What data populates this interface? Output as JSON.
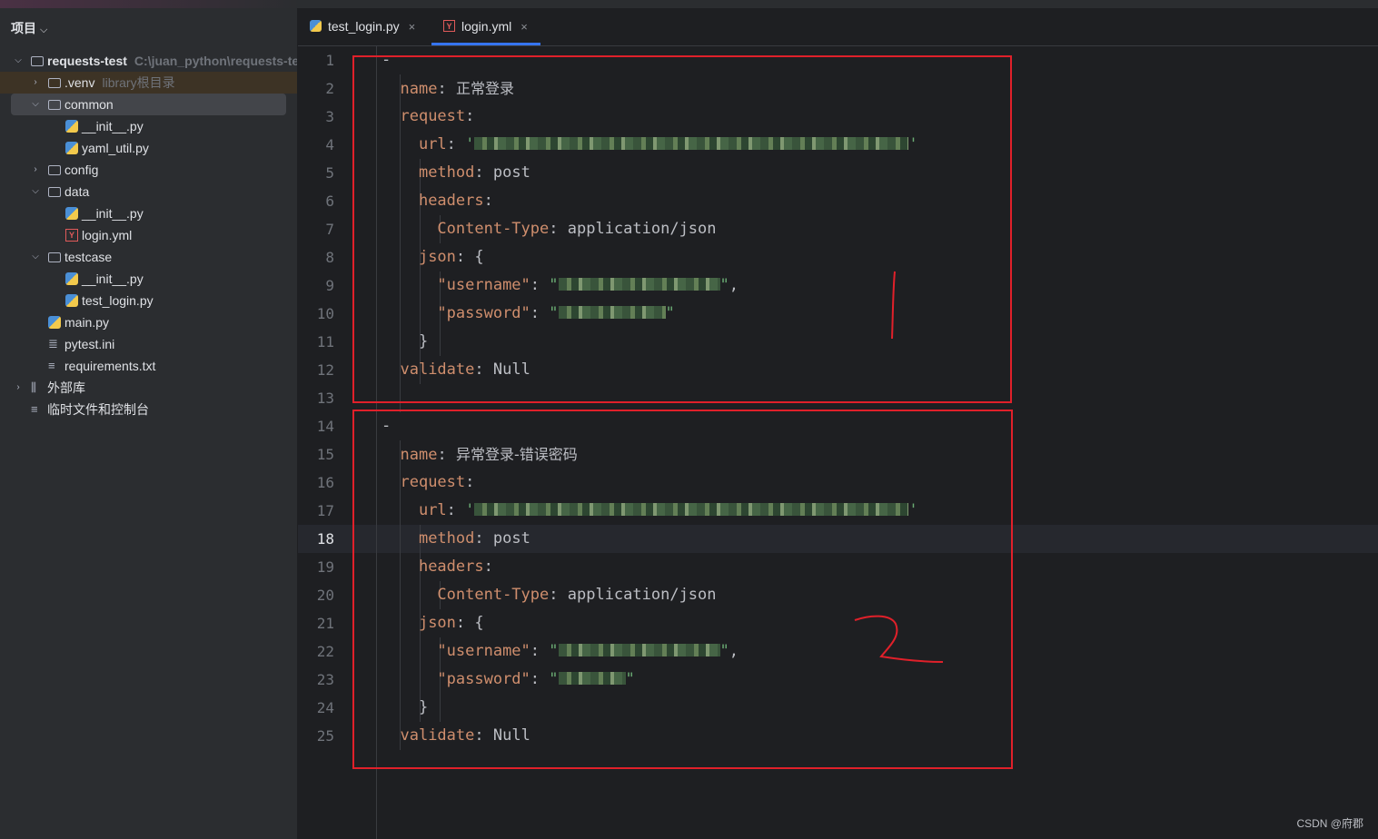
{
  "sidebar": {
    "title": "项目",
    "items": [
      {
        "label": "requests-test",
        "hint": "C:\\juan_python\\requests-test"
      },
      {
        "label": ".venv",
        "hint": "library根目录"
      },
      {
        "label": "common"
      },
      {
        "label": "__init__.py"
      },
      {
        "label": "yaml_util.py"
      },
      {
        "label": "config"
      },
      {
        "label": "data"
      },
      {
        "label": "__init__.py"
      },
      {
        "label": "login.yml"
      },
      {
        "label": "testcase"
      },
      {
        "label": "__init__.py"
      },
      {
        "label": "test_login.py"
      },
      {
        "label": "main.py"
      },
      {
        "label": "pytest.ini"
      },
      {
        "label": "requirements.txt"
      },
      {
        "label": "外部库"
      },
      {
        "label": "临时文件和控制台"
      }
    ]
  },
  "tabs": [
    {
      "label": "test_login.py",
      "icon": "python-file-icon",
      "close": "×"
    },
    {
      "label": "login.yml",
      "icon": "yaml-file-icon",
      "close": "×",
      "active": true
    }
  ],
  "editor": {
    "current_line": 18,
    "line_numbers": [
      "1",
      "2",
      "3",
      "4",
      "5",
      "6",
      "7",
      "8",
      "9",
      "10",
      "11",
      "12",
      "13",
      "14",
      "15",
      "16",
      "17",
      "18",
      "19",
      "20",
      "21",
      "22",
      "23",
      "24",
      "25"
    ],
    "tokens": {
      "dash": "-",
      "name_key": "name",
      "colon": ":",
      "name_value_1": "正常登录",
      "name_value_2": "异常登录-错误密码",
      "request_key": "request",
      "url_key": "url",
      "quote": "'",
      "method_key": "method",
      "method_value": "post",
      "headers_key": "headers",
      "content_type_key": "Content-Type",
      "content_type_value": "application/json",
      "json_key": "json",
      "open_brace": "{",
      "close_brace": "}",
      "username_key": "\"username\"",
      "password_key": "\"password\"",
      "dquote": "\"",
      "comma": ",",
      "validate_key": "validate",
      "validate_value": "Null"
    }
  },
  "annotations": {
    "box_1_mark": "1",
    "box_2_mark": "2"
  },
  "watermark": "CSDN @府郡"
}
